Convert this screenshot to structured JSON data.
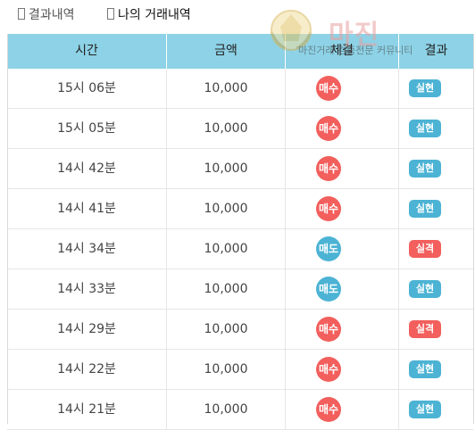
{
  "tabs": [
    {
      "label": "결과내역",
      "icon": "document-icon"
    },
    {
      "label": "나의 거래내역",
      "icon": "document-icon"
    }
  ],
  "watermark": {
    "brand": "마진",
    "tagline": "마진거래 검증전문 커뮤니티"
  },
  "table": {
    "headers": [
      "시간",
      "금액",
      "체결",
      "결과"
    ],
    "rows": [
      {
        "time": "15시 06분",
        "amount": "10,000",
        "trade": "매수",
        "result": "실현"
      },
      {
        "time": "15시 05분",
        "amount": "10,000",
        "trade": "매수",
        "result": "실현"
      },
      {
        "time": "14시 42분",
        "amount": "10,000",
        "trade": "매수",
        "result": "실현"
      },
      {
        "time": "14시 41분",
        "amount": "10,000",
        "trade": "매수",
        "result": "실현"
      },
      {
        "time": "14시 34분",
        "amount": "10,000",
        "trade": "매도",
        "result": "실격"
      },
      {
        "time": "14시 33분",
        "amount": "10,000",
        "trade": "매도",
        "result": "실현"
      },
      {
        "time": "14시 29분",
        "amount": "10,000",
        "trade": "매수",
        "result": "실격"
      },
      {
        "time": "14시 22분",
        "amount": "10,000",
        "trade": "매수",
        "result": "실현"
      },
      {
        "time": "14시 21분",
        "amount": "10,000",
        "trade": "매수",
        "result": "실현"
      }
    ]
  },
  "colors": {
    "header_bg": "#8dd2e6",
    "buy": "#f25f5c",
    "sell": "#4cb3d4",
    "realized": "#4cb3d4",
    "failed": "#f25f5c"
  }
}
